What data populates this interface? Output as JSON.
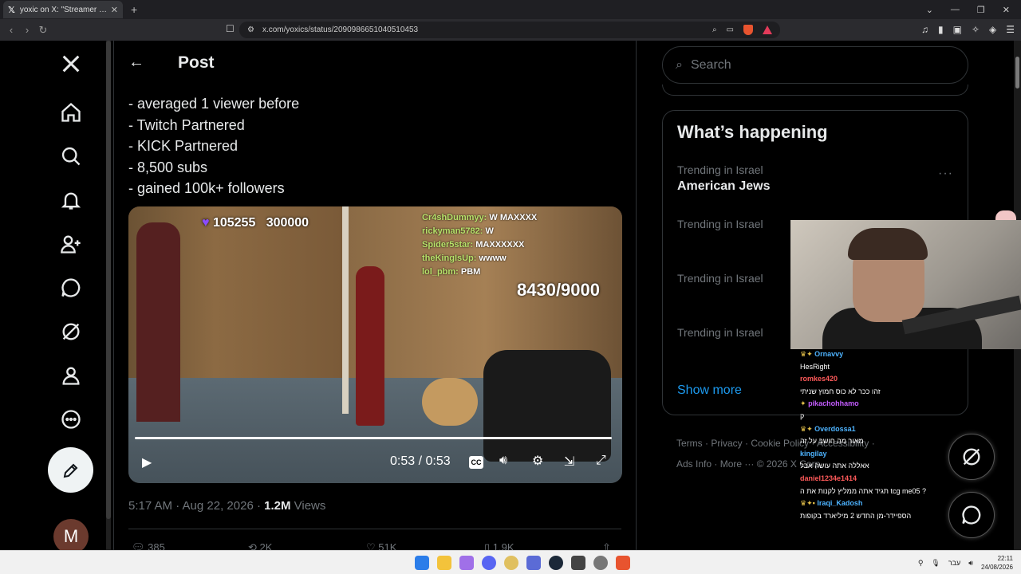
{
  "browser": {
    "tab_title": "yoxic on X: \"Streamer \"Nitro_Can",
    "tab_close": "✕",
    "new_tab": "+",
    "url": "x.com/yoxics/status/2090986651040510453",
    "window_controls": [
      "⌄",
      "—",
      "❐",
      "✕"
    ],
    "accent": "#e8542f"
  },
  "sidebar": {
    "items": [
      {
        "icon": "x-logo-icon"
      },
      {
        "icon": "home-icon"
      },
      {
        "icon": "explore-icon"
      },
      {
        "icon": "notifications-icon"
      },
      {
        "icon": "follow-icon"
      },
      {
        "icon": "messages-icon"
      },
      {
        "icon": "grok-icon"
      },
      {
        "icon": "profile-icon"
      },
      {
        "icon": "more-icon"
      }
    ],
    "avatar_letter": "M"
  },
  "post": {
    "header_title": "Post",
    "lines": [
      "- averaged 1 viewer before",
      "- Twitch Partnered",
      "- KICK Partnered",
      "- 8,500 subs",
      "- gained 100k+ followers"
    ],
    "video": {
      "sub_count": "105255",
      "sub_target": "300000",
      "goal": "8430/9000",
      "chat": [
        {
          "user": "Cr4shDummyy:",
          "msg": "W  MAXXXX"
        },
        {
          "user": "rickyman5782:",
          "msg": "W"
        },
        {
          "user": "Spider5star:",
          "msg": "MAXXXXXX"
        },
        {
          "user": "theKingIsUp:",
          "msg": "wwww"
        },
        {
          "user": "lol_pbm:",
          "msg": "PBM"
        }
      ],
      "time": "0:53 / 0:53",
      "cc": "CC",
      "progress": 1.0
    },
    "timestamp": "5:17 AM · Aug 22, 2026 · ",
    "views_num": "1.2M",
    "views_label": " Views",
    "actions": [
      "385",
      "2K",
      "51K",
      "1.9K"
    ]
  },
  "right": {
    "search_placeholder": "Search",
    "whats_happening": "What’s happening",
    "trends": [
      {
        "context": "Trending in Israel",
        "topic": "American Jews"
      },
      {
        "context": "Trending in Israel",
        "topic": ""
      },
      {
        "context": "Trending in Israel",
        "topic": ""
      },
      {
        "context": "Trending in Israel",
        "topic": ""
      }
    ],
    "more_dots": "···",
    "show_more": "Show more",
    "footer_line1": "Terms  ·  Privacy  ·  Cookie Policy  ·  Accessibility  ·",
    "footer_line2": "Ads Info  ·  More ···  © 2026 X Corp."
  },
  "stream_chat": [
    {
      "user": "Ornavvy",
      "msg": "HesRight",
      "color": "g"
    },
    {
      "user": "romkes420",
      "msg": "זהו ככר לא כוס חמוץ שניתי",
      "color": "r"
    },
    {
      "user": "pikachohhamo",
      "msg": "ק",
      "color": "y"
    },
    {
      "user": "Overdossa1",
      "msg": "מאור מה חושב על זה",
      "color": "g"
    },
    {
      "user": "kingilay",
      "msg": "אאללה אתה עושה אבל",
      "color": "g"
    },
    {
      "user": "daniel1234e1414",
      "msg": "? tcg me05 תגיד אתה ממליץ לקנות את ה",
      "color": "r"
    },
    {
      "user": "Iraqi_Kadosh",
      "msg": "הספיידר-מן החדש 2 מיליארד בקופות",
      "color": "g"
    }
  ],
  "taskbar": {
    "lang": "עבר",
    "time": "22:11",
    "date": "24/08/2026"
  }
}
